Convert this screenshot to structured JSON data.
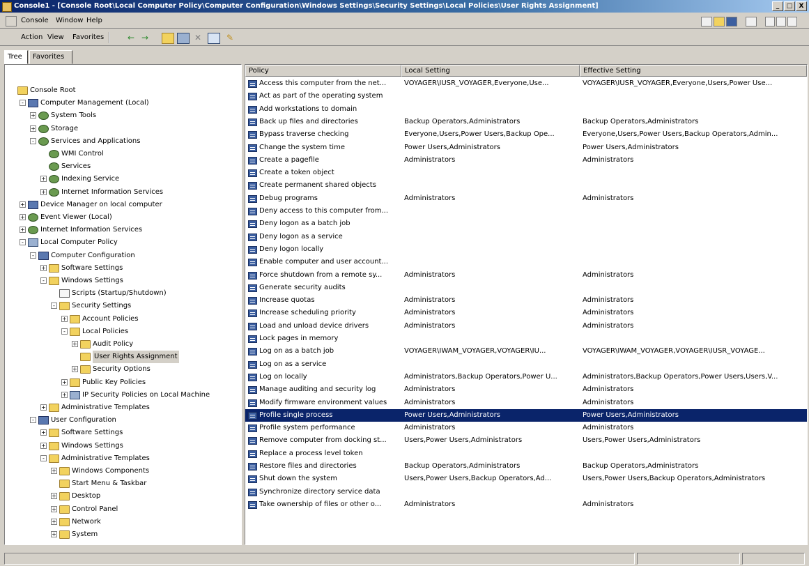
{
  "window": {
    "title": "Console1 - [Console Root\\Local Computer Policy\\Computer Configuration\\Windows Settings\\Security Settings\\Local Policies\\User Rights Assignment]",
    "caption_buttons": [
      "_",
      "□",
      "X"
    ]
  },
  "menubar": {
    "items": [
      "Console",
      "Window",
      "Help"
    ]
  },
  "toolbar": {
    "items": [
      "Action",
      "View",
      "Favorites"
    ]
  },
  "left_pane": {
    "tabs": [
      "Tree",
      "Favorites"
    ],
    "tree": [
      {
        "label": "Console Root",
        "icon": "folder-icon",
        "expander": ""
      },
      {
        "label": "Computer Management (Local)",
        "icon": "computer-icon",
        "expander": "-"
      },
      {
        "label": "System Tools",
        "icon": "gear-icon",
        "expander": "+"
      },
      {
        "label": "Storage",
        "icon": "gear-icon",
        "expander": "+"
      },
      {
        "label": "Services and Applications",
        "icon": "gear-icon",
        "expander": "-"
      },
      {
        "label": "WMI Control",
        "icon": "gear-icon",
        "expander": ""
      },
      {
        "label": "Services",
        "icon": "gear-icon",
        "expander": ""
      },
      {
        "label": "Indexing Service",
        "icon": "gear-icon",
        "expander": "+"
      },
      {
        "label": "Internet Information Services",
        "icon": "gear-icon",
        "expander": "+"
      },
      {
        "label": "Device Manager on local computer",
        "icon": "computer-icon",
        "expander": "+"
      },
      {
        "label": "Event Viewer (Local)",
        "icon": "gear-icon",
        "expander": "+"
      },
      {
        "label": "Internet Information Services",
        "icon": "gear-icon",
        "expander": "+"
      },
      {
        "label": "Local Computer Policy",
        "icon": "policy-icon",
        "expander": "-"
      },
      {
        "label": "Computer Configuration",
        "icon": "computer-icon",
        "expander": "-"
      },
      {
        "label": "Software Settings",
        "icon": "folder-icon",
        "expander": "+"
      },
      {
        "label": "Windows Settings",
        "icon": "folder-icon",
        "expander": "-"
      },
      {
        "label": "Scripts (Startup/Shutdown)",
        "icon": "script-icon",
        "expander": ""
      },
      {
        "label": "Security Settings",
        "icon": "folder-icon",
        "expander": "-"
      },
      {
        "label": "Account Policies",
        "icon": "folder-icon",
        "expander": "+"
      },
      {
        "label": "Local Policies",
        "icon": "folder-icon",
        "expander": "-"
      },
      {
        "label": "Audit Policy",
        "icon": "folder-icon",
        "expander": "+"
      },
      {
        "label": "User Rights Assignment",
        "icon": "folder-icon",
        "expander": "",
        "selected": true
      },
      {
        "label": "Security Options",
        "icon": "folder-icon",
        "expander": "+"
      },
      {
        "label": "Public Key Policies",
        "icon": "folder-icon",
        "expander": "+"
      },
      {
        "label": "IP Security Policies on Local Machine",
        "icon": "policy-icon",
        "expander": "+"
      },
      {
        "label": "Administrative Templates",
        "icon": "folder-icon",
        "expander": "+"
      },
      {
        "label": "User Configuration",
        "icon": "computer-icon",
        "expander": "-"
      },
      {
        "label": "Software Settings",
        "icon": "folder-icon",
        "expander": "+"
      },
      {
        "label": "Windows Settings",
        "icon": "folder-icon",
        "expander": "+"
      },
      {
        "label": "Administrative Templates",
        "icon": "folder-icon",
        "expander": "-"
      },
      {
        "label": "Windows Components",
        "icon": "folder-icon",
        "expander": "+"
      },
      {
        "label": "Start Menu & Taskbar",
        "icon": "folder-icon",
        "expander": ""
      },
      {
        "label": "Desktop",
        "icon": "folder-icon",
        "expander": "+"
      },
      {
        "label": "Control Panel",
        "icon": "folder-icon",
        "expander": "+"
      },
      {
        "label": "Network",
        "icon": "folder-icon",
        "expander": "+"
      },
      {
        "label": "System",
        "icon": "folder-icon",
        "expander": "+"
      }
    ]
  },
  "right_pane": {
    "columns": [
      "Policy",
      "Local Setting",
      "Effective Setting"
    ],
    "rows": [
      [
        "Access this computer from the net...",
        "VOYAGER\\IUSR_VOYAGER,Everyone,Use...",
        "VOYAGER\\IUSR_VOYAGER,Everyone,Users,Power Use..."
      ],
      [
        "Act as part of the operating system",
        "",
        ""
      ],
      [
        "Add workstations to domain",
        "",
        ""
      ],
      [
        "Back up files and directories",
        "Backup Operators,Administrators",
        "Backup Operators,Administrators"
      ],
      [
        "Bypass traverse checking",
        "Everyone,Users,Power Users,Backup Ope...",
        "Everyone,Users,Power Users,Backup Operators,Admin..."
      ],
      [
        "Change the system time",
        "Power Users,Administrators",
        "Power Users,Administrators"
      ],
      [
        "Create a pagefile",
        "Administrators",
        "Administrators"
      ],
      [
        "Create a token object",
        "",
        ""
      ],
      [
        "Create permanent shared objects",
        "",
        ""
      ],
      [
        "Debug programs",
        "Administrators",
        "Administrators"
      ],
      [
        "Deny access to this computer from...",
        "",
        ""
      ],
      [
        "Deny logon as a batch job",
        "",
        ""
      ],
      [
        "Deny logon as a service",
        "",
        ""
      ],
      [
        "Deny logon locally",
        "",
        ""
      ],
      [
        "Enable computer and user account...",
        "",
        ""
      ],
      [
        "Force shutdown from a remote sy...",
        "Administrators",
        "Administrators"
      ],
      [
        "Generate security audits",
        "",
        ""
      ],
      [
        "Increase quotas",
        "Administrators",
        "Administrators"
      ],
      [
        "Increase scheduling priority",
        "Administrators",
        "Administrators"
      ],
      [
        "Load and unload device drivers",
        "Administrators",
        "Administrators"
      ],
      [
        "Lock pages in memory",
        "",
        ""
      ],
      [
        "Log on as a batch job",
        "VOYAGER\\IWAM_VOYAGER,VOYAGER\\IU...",
        "VOYAGER\\IWAM_VOYAGER,VOYAGER\\IUSR_VOYAGE..."
      ],
      [
        "Log on as a service",
        "",
        ""
      ],
      [
        "Log on locally",
        "Administrators,Backup Operators,Power U...",
        "Administrators,Backup Operators,Power Users,Users,V..."
      ],
      [
        "Manage auditing and security log",
        "Administrators",
        "Administrators"
      ],
      [
        "Modify firmware environment values",
        "Administrators",
        "Administrators"
      ],
      [
        "Profile single process",
        "Power Users,Administrators",
        "Power Users,Administrators"
      ],
      [
        "Profile system performance",
        "Administrators",
        "Administrators"
      ],
      [
        "Remove computer from docking st...",
        "Users,Power Users,Administrators",
        "Users,Power Users,Administrators"
      ],
      [
        "Replace a process level token",
        "",
        ""
      ],
      [
        "Restore files and directories",
        "Backup Operators,Administrators",
        "Backup Operators,Administrators"
      ],
      [
        "Shut down the system",
        "Users,Power Users,Backup Operators,Ad...",
        "Users,Power Users,Backup Operators,Administrators"
      ],
      [
        "Synchronize directory service data",
        "",
        ""
      ],
      [
        "Take ownership of files or other o...",
        "Administrators",
        "Administrators"
      ]
    ],
    "selected_row": 26
  },
  "colors": {
    "selection": "#0a246a",
    "face": "#d4d0c8",
    "title_gradient_start": "#0a246a"
  }
}
